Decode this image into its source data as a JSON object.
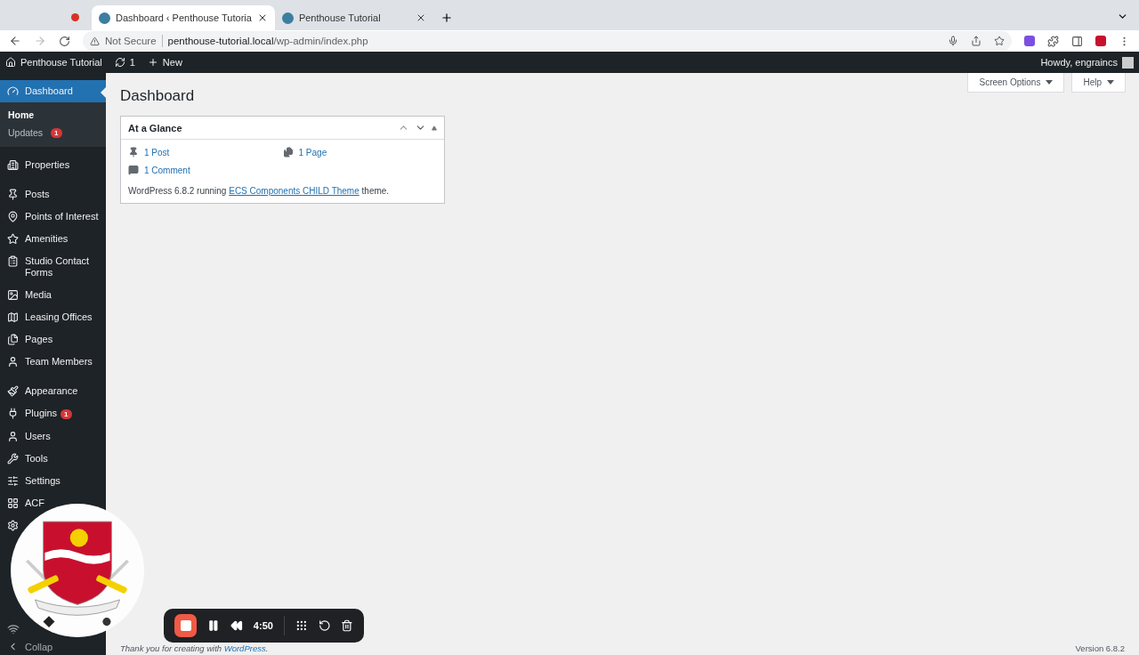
{
  "browser": {
    "tabs": [
      {
        "title": "Dashboard ‹ Penthouse Tutoria",
        "selected": true
      },
      {
        "title": "Penthouse Tutorial",
        "selected": false
      }
    ],
    "security": "Not Secure",
    "url_host": "penthouse-tutorial.local",
    "url_path": "/wp-admin/index.php"
  },
  "admin_bar": {
    "site": "Penthouse Tutorial",
    "updates": "1",
    "new": "New",
    "greeting": "Howdy, engraincs"
  },
  "sidebar": {
    "items": [
      {
        "label": "Dashboard",
        "selected": true,
        "children": [
          {
            "label": "Home",
            "selected": true
          },
          {
            "label": "Updates",
            "badge": "1",
            "selected": false
          }
        ]
      },
      {
        "label": "Properties",
        "selected": false
      },
      {
        "label": "Posts",
        "selected": false
      },
      {
        "label": "Points of Interest",
        "selected": false
      },
      {
        "label": "Amenities",
        "selected": false
      },
      {
        "label": "Studio Contact Forms",
        "selected": false
      },
      {
        "label": "Media",
        "selected": false
      },
      {
        "label": "Leasing Offices",
        "selected": false
      },
      {
        "label": "Pages",
        "selected": false
      },
      {
        "label": "Team Members",
        "selected": false
      },
      {
        "label": "Appearance",
        "selected": false
      },
      {
        "label": "Plugins",
        "badge": "1",
        "selected": false
      },
      {
        "label": "Users",
        "selected": false
      },
      {
        "label": "Tools",
        "selected": false
      },
      {
        "label": "Settings",
        "selected": false
      },
      {
        "label": "ACF",
        "selected": false
      }
    ],
    "collapse": "Collap"
  },
  "page": {
    "title": "Dashboard",
    "screen_options": "Screen Options",
    "help": "Help"
  },
  "widget": {
    "title": "At a Glance",
    "items": [
      {
        "kind": "post",
        "label": "1 Post"
      },
      {
        "kind": "page",
        "label": "1 Page"
      },
      {
        "kind": "comment",
        "label": "1 Comment"
      }
    ],
    "footer_before": "WordPress 6.8.2 running ",
    "footer_link": "ECS Components CHILD Theme",
    "footer_after": " theme."
  },
  "footer": {
    "thanks": "Thank you for creating with ",
    "link": "WordPress",
    "suffix": ".",
    "version": "Version 6.8.2"
  },
  "recorder": {
    "time": "4:50"
  }
}
